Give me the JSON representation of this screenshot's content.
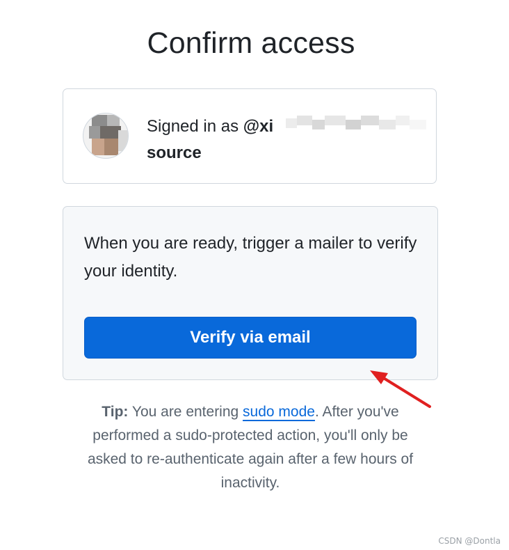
{
  "page": {
    "title": "Confirm access"
  },
  "account": {
    "signed_in_prefix": "Signed in as ",
    "username": "@xi",
    "org": "source"
  },
  "verify": {
    "message": "When you are ready, trigger a mailer to verify your identity.",
    "button_label": "Verify via email"
  },
  "tip": {
    "label": "Tip:",
    "text_before": " You are entering ",
    "link_text": "sudo mode",
    "text_after": ". After you've performed a sudo-protected action, you'll only be asked to re-authenticate again after a few hours of inactivity."
  },
  "watermark": "CSDN @Dontla",
  "colors": {
    "accent": "#0969da",
    "annotation_arrow": "#e02020"
  }
}
